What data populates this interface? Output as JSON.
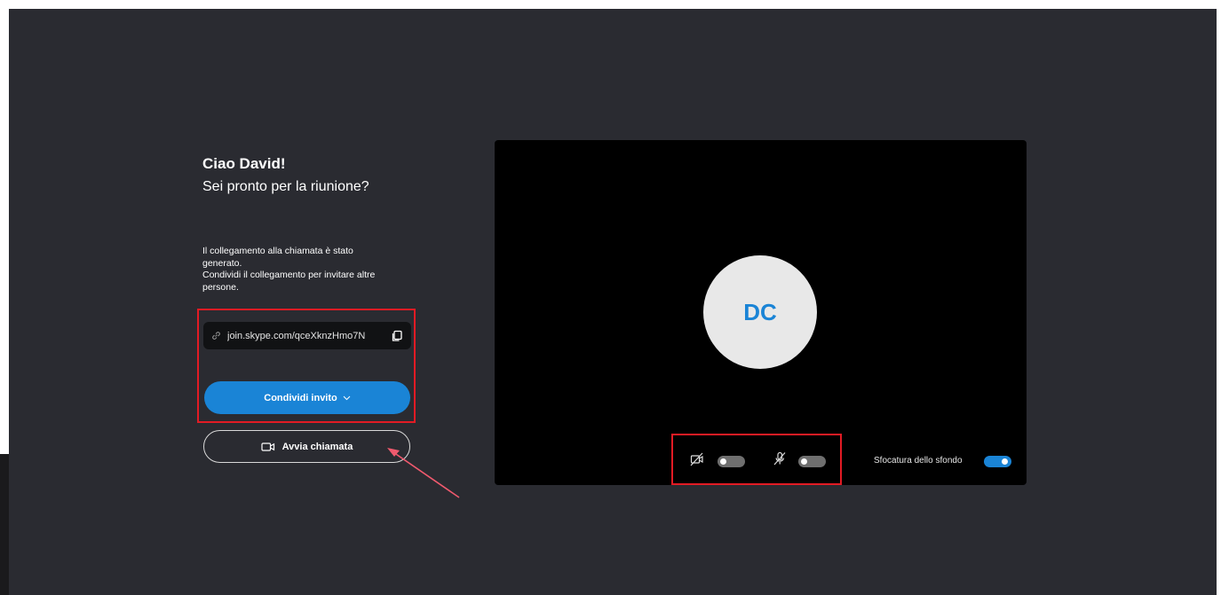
{
  "greeting": "Ciao David!",
  "subgreeting": "Sei pronto per la riunione?",
  "info_lines": [
    "Il collegamento alla chiamata è stato",
    "generato.",
    "Condividi il collegamento per invitare altre",
    "persone."
  ],
  "invite_link": "join.skype.com/qceXknzHmo7N",
  "share_button_label": "Condividi invito",
  "start_call_label": "Avvia chiamata",
  "avatar_initials": "DC",
  "video_toggle_on": false,
  "mic_toggle_on": false,
  "blur_label": "Sfocatura dello sfondo",
  "blur_toggle_on": true,
  "colors": {
    "accent": "#1a84d6",
    "highlight": "#e21b24",
    "background": "#2a2b31"
  }
}
